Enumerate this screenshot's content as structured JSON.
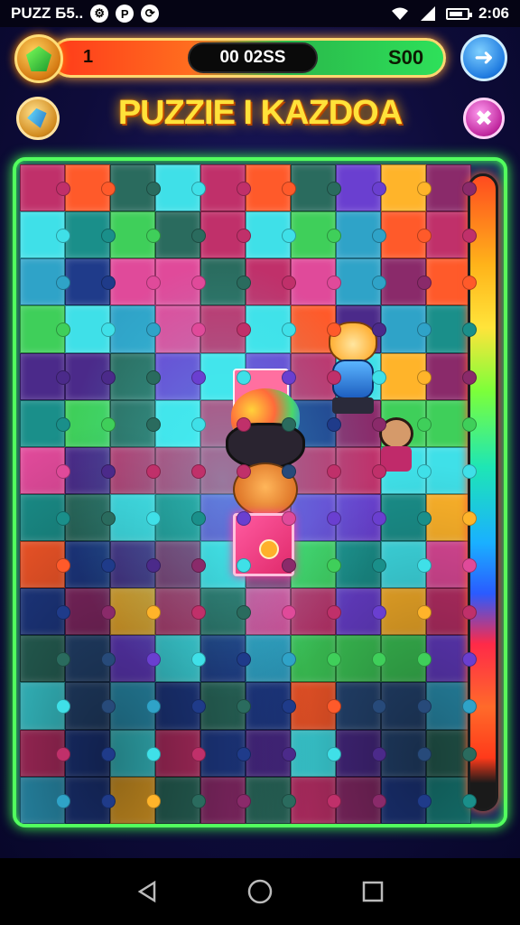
{
  "status_bar": {
    "app_label": "PUZZ Б5..",
    "time": "2:06",
    "notification_icons": [
      "settings-icon",
      "p-icon",
      "cycle-icon"
    ]
  },
  "hud": {
    "level": "1",
    "score": "00 02SS",
    "coins": "S00",
    "gem_icon": "gem-icon",
    "next_icon": "arrow-right-icon"
  },
  "header": {
    "title": "PUZZIE I KAZDOA",
    "tool_icon": "hammer-icon",
    "close_icon": "close-icon"
  },
  "board": {
    "columns": 10,
    "rows": 14,
    "palette": [
      "#1f3b8a",
      "#2a6b5e",
      "#2fa3c8",
      "#3fe0e8",
      "#4b2a8a",
      "#8a2a6a",
      "#c0306a",
      "#ff5a2a",
      "#ffb42a",
      "#3fcf5a",
      "#1a8f8a",
      "#274a7a",
      "#6a3fd0",
      "#e04a9a"
    ]
  },
  "nav": {
    "back_icon": "back-icon",
    "home_icon": "home-icon",
    "recents_icon": "recents-icon"
  }
}
